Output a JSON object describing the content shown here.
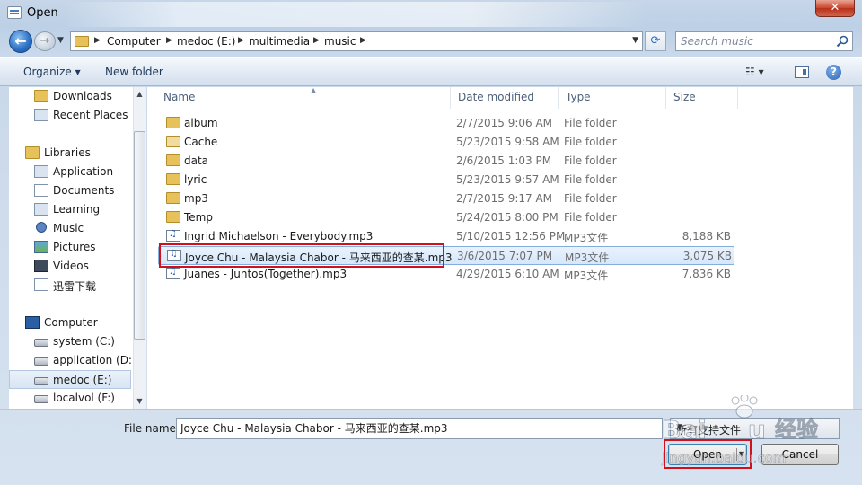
{
  "window": {
    "title": "Open",
    "close_glyph": "✕"
  },
  "address": {
    "crumbs": [
      "Computer",
      "medoc (E:)",
      "multimedia",
      "music"
    ],
    "search_placeholder": "Search music"
  },
  "toolbar": {
    "organize": "Organize",
    "new_folder": "New folder",
    "help": "?"
  },
  "nav": {
    "items": [
      {
        "label": "Downloads",
        "icon": "folder-icon"
      },
      {
        "label": "Recent Places",
        "icon": "recent-places-icon"
      },
      {
        "label": "Libraries",
        "icon": "libraries-icon"
      },
      {
        "label": "Application",
        "icon": "library-folder-icon"
      },
      {
        "label": "Documents",
        "icon": "documents-icon"
      },
      {
        "label": "Learning",
        "icon": "library-folder-icon"
      },
      {
        "label": "Music",
        "icon": "music-icon"
      },
      {
        "label": "Pictures",
        "icon": "pictures-icon"
      },
      {
        "label": "Videos",
        "icon": "videos-icon"
      },
      {
        "label": "迅雷下载",
        "icon": "library-folder-icon"
      },
      {
        "label": "Computer",
        "icon": "computer-icon"
      },
      {
        "label": "system (C:)",
        "icon": "drive-icon"
      },
      {
        "label": "application (D:)",
        "icon": "drive-icon"
      },
      {
        "label": "medoc (E:)",
        "icon": "drive-icon",
        "selected": true
      },
      {
        "label": "localvol (F:)",
        "icon": "drive-icon"
      }
    ]
  },
  "columns": {
    "name": "Name",
    "date": "Date modified",
    "type": "Type",
    "size": "Size"
  },
  "files": [
    {
      "name": "album",
      "date": "2/7/2015 9:06 AM",
      "type": "File folder",
      "size": "",
      "kind": "folder"
    },
    {
      "name": "Cache",
      "date": "5/23/2015 9:58 AM",
      "type": "File folder",
      "size": "",
      "kind": "folder"
    },
    {
      "name": "data",
      "date": "2/6/2015 1:03 PM",
      "type": "File folder",
      "size": "",
      "kind": "folder"
    },
    {
      "name": "lyric",
      "date": "5/23/2015 9:57 AM",
      "type": "File folder",
      "size": "",
      "kind": "folder"
    },
    {
      "name": "mp3",
      "date": "2/7/2015 9:17 AM",
      "type": "File folder",
      "size": "",
      "kind": "folder"
    },
    {
      "name": "Temp",
      "date": "5/24/2015 8:00 PM",
      "type": "File folder",
      "size": "",
      "kind": "folder"
    },
    {
      "name": "Ingrid Michaelson - Everybody.mp3",
      "date": "5/10/2015 12:56 PM",
      "type": "MP3文件",
      "size": "8,188 KB",
      "kind": "mp3"
    },
    {
      "name": "Joyce Chu - Malaysia Chabor - 马来西亚的查某.mp3",
      "date": "3/6/2015 7:07 PM",
      "type": "MP3文件",
      "size": "3,075 KB",
      "kind": "mp3",
      "selected": true
    },
    {
      "name": "Juanes - Juntos(Together).mp3",
      "date": "4/29/2015 6:10 AM",
      "type": "MP3文件",
      "size": "7,836 KB",
      "kind": "mp3"
    }
  ],
  "bottom": {
    "filename_label": "File name:",
    "filename_value": "Joyce Chu - Malaysia Chabor - 马来西亚的查某.mp3",
    "filetype_value": "所有支持文件",
    "open_label": "Open",
    "cancel_label": "Cancel"
  },
  "watermark": {
    "text": "Baidu 经验",
    "url_text": "jingyan.baidu.com"
  },
  "colors": {
    "highlight": "#d0101a",
    "selection": "#d5e7fb"
  }
}
